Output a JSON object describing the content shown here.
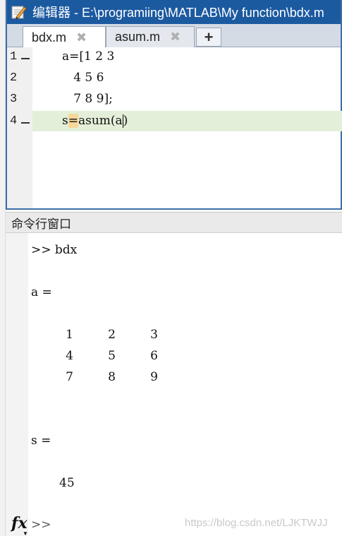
{
  "editor": {
    "title": "编辑器 - E:\\programiing\\MATLAB\\My function\\bdx.m",
    "tabs": [
      {
        "label": "bdx.m",
        "close": "✖"
      },
      {
        "label": "asum.m",
        "close": "✖"
      }
    ],
    "add_tab": "+",
    "line_numbers": [
      "1",
      "2",
      "3",
      "4"
    ],
    "lines": [
      "a=[1 2 3",
      "   4 5 6",
      "   7 8 9];"
    ],
    "line4_pre": "s",
    "line4_hl": "=",
    "line4_mid": "asum(a",
    "line4_post": ")"
  },
  "command_window": {
    "title": "命令行窗口",
    "prompt_cmd": ">> bdx",
    "a_label": "a =",
    "matrix": [
      [
        "1",
        "2",
        "3"
      ],
      [
        "4",
        "5",
        "6"
      ],
      [
        "7",
        "8",
        "9"
      ]
    ],
    "s_label": "s =",
    "s_value": "45",
    "fx": "fx",
    "prompt": ">>",
    "watermark": "https://blog.csdn.net/LJKTWJJ"
  },
  "colors": {
    "titlebar": "#1c5aa0",
    "current_line": "#e3efd8",
    "bracket_match": "#f7d79a"
  }
}
